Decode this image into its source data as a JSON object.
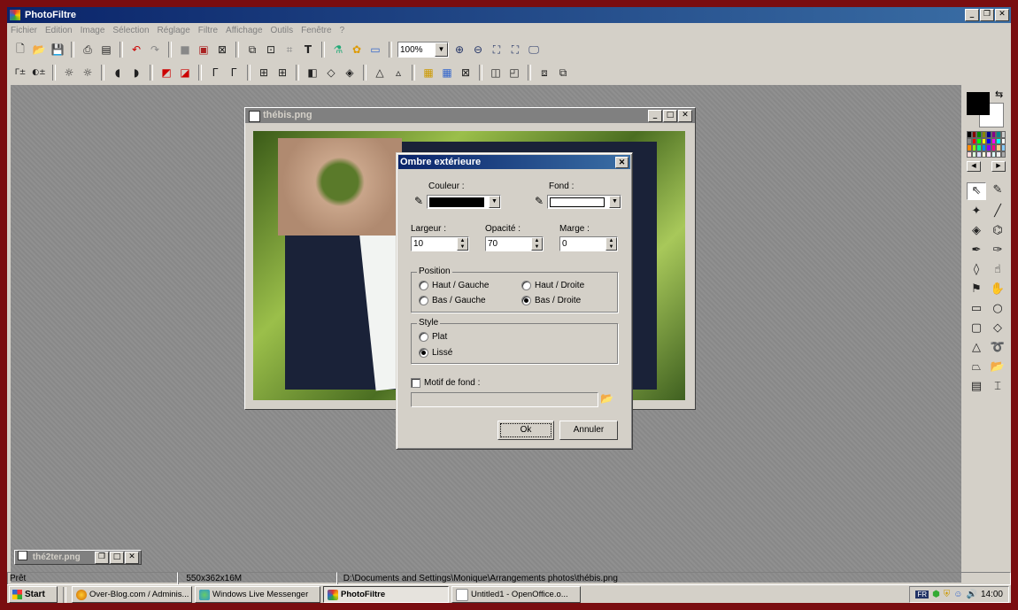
{
  "app": {
    "title": "PhotoFiltre"
  },
  "menu": [
    "Fichier",
    "Edition",
    "Image",
    "Sélection",
    "Réglage",
    "Filtre",
    "Affichage",
    "Outils",
    "Fenêtre",
    "?"
  ],
  "toolbar": {
    "zoom": "100%"
  },
  "document": {
    "title": "thébis.png"
  },
  "dialog": {
    "title": "Ombre extérieure",
    "couleur_label": "Couleur :",
    "fond_label": "Fond :",
    "couleur_value": "#000000",
    "fond_value": "#ffffff",
    "largeur_label": "Largeur :",
    "opacite_label": "Opacité :",
    "marge_label": "Marge :",
    "largeur_value": "10",
    "opacite_value": "70",
    "marge_value": "0",
    "position_title": "Position",
    "pos_haut_gauche": "Haut / Gauche",
    "pos_haut_droite": "Haut / Droite",
    "pos_bas_gauche": "Bas / Gauche",
    "pos_bas_droite": "Bas / Droite",
    "position_selected": "Bas / Droite",
    "style_title": "Style",
    "style_plat": "Plat",
    "style_lisse": "Lissé",
    "style_selected": "Lissé",
    "motif_label": "Motif de fond :",
    "motif_checked": false,
    "ok": "Ok",
    "cancel": "Annuler"
  },
  "minimized": {
    "title": "thé2ter.png"
  },
  "status": {
    "state": "Prêt",
    "size": "550x362x16M",
    "path": "D:\\Documents and Settings\\Monique\\Arrangements photos\\thébis.png"
  },
  "taskbar": {
    "start": "Start",
    "tasks": [
      "Over-Blog.com / Adminis...",
      "Windows Live Messenger",
      "PhotoFiltre",
      "Untitled1 - OpenOffice.o..."
    ],
    "active": "PhotoFiltre",
    "lang": "FR",
    "clock": "14:00"
  }
}
